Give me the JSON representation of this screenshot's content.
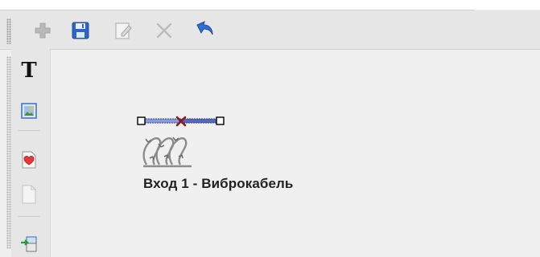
{
  "toolbar": {
    "buttons": [
      {
        "name": "add",
        "icon": "plus-icon",
        "enabled": false
      },
      {
        "name": "save",
        "icon": "save-icon",
        "enabled": true
      },
      {
        "name": "edit",
        "icon": "edit-icon",
        "enabled": false
      },
      {
        "name": "delete",
        "icon": "close-icon",
        "enabled": false
      },
      {
        "name": "undo",
        "icon": "undo-icon",
        "enabled": true
      }
    ]
  },
  "side_toolbar": {
    "text_tool": "T",
    "items": [
      "text-tool-icon",
      "image-tool-icon",
      "heart-document-icon",
      "blank-document-icon",
      "transfer-icon"
    ]
  },
  "canvas": {
    "element_label": "Вход 1 - Виброкабель",
    "element_icon": "barbed-wire-icon"
  },
  "colors": {
    "accent_blue": "#1f5fb8",
    "marker_red": "#8b1a1a",
    "toolbar_bg": "#e6e6e6",
    "canvas_bg": "#f0f0f0"
  }
}
